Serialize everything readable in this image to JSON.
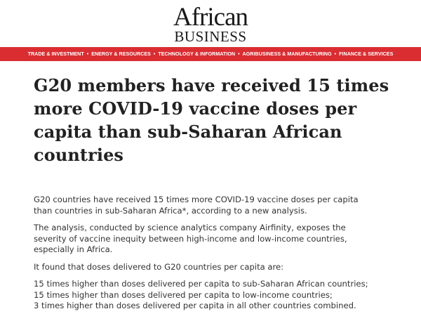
{
  "logo": {
    "line1": "African",
    "line2": "BUSINESS"
  },
  "nav": {
    "items": [
      "TRADE & INVESTMENT",
      "ENERGY & RESOURCES",
      "TECHNOLOGY & INFORMATION",
      "AGRIBUSINESS & MANUFACTURING",
      "FINANCE & SERVICES"
    ],
    "separator": "•"
  },
  "article": {
    "headline": "G20 members have received 15 times more COVID-19 vaccine doses per capita than sub-Saharan African countries",
    "paragraphs": [
      {
        "lines": [
          "G20 countries have received 15 times more COVID-19 vaccine doses per capita",
          "than countries in sub-Saharan Africa*, according to a new analysis."
        ]
      },
      {
        "lines": [
          "The analysis, conducted by science analytics company Airfinity, exposes the",
          "severity of vaccine inequity between high-income and low-income countries,",
          "especially in Africa."
        ]
      },
      {
        "lines": [
          "It found that doses delivered to G20 countries per capita are:"
        ]
      },
      {
        "lines": [
          "15 times higher than doses delivered per capita to sub-Saharan African countries;",
          "15 times higher than doses delivered per capita to low-income countries;",
          "3 times higher than doses delivered per capita in all other countries combined."
        ]
      }
    ]
  },
  "colors": {
    "nav_bg": "#d92d32",
    "nav_text": "#ffffff",
    "headline": "#222222",
    "body_text": "#333333"
  }
}
